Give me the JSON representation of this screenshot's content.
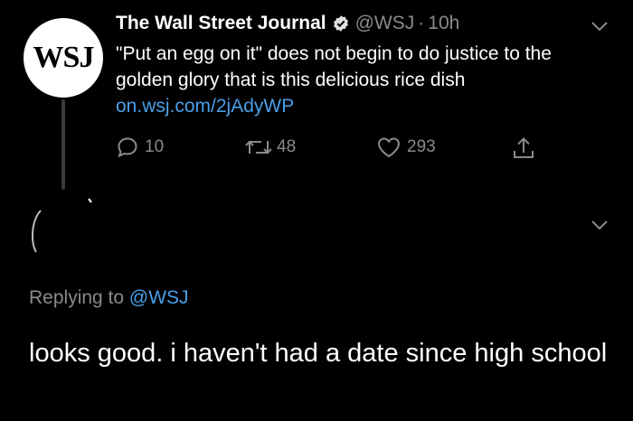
{
  "tweet": {
    "avatar_text": "WSJ",
    "author_name": "The Wall Street Journal",
    "handle": "@WSJ",
    "separator": "·",
    "time": "10h",
    "text": "\"Put an egg on it\" does not begin to do justice to the golden glory that is this delicious rice dish ",
    "link": "on.wsj.com/2jAdyWP",
    "replies": "10",
    "retweets": "48",
    "likes": "293"
  },
  "reply": {
    "replying_prefix": "Replying to ",
    "replying_handle": "@WSJ",
    "text": "looks good. i haven't had a date since high school"
  },
  "colors": {
    "background": "#000000",
    "muted": "#8a8a8a",
    "link": "#4a9fe8"
  },
  "icons": [
    "verified-icon",
    "chevron-down-icon",
    "reply-icon",
    "retweet-icon",
    "like-icon",
    "share-icon"
  ]
}
